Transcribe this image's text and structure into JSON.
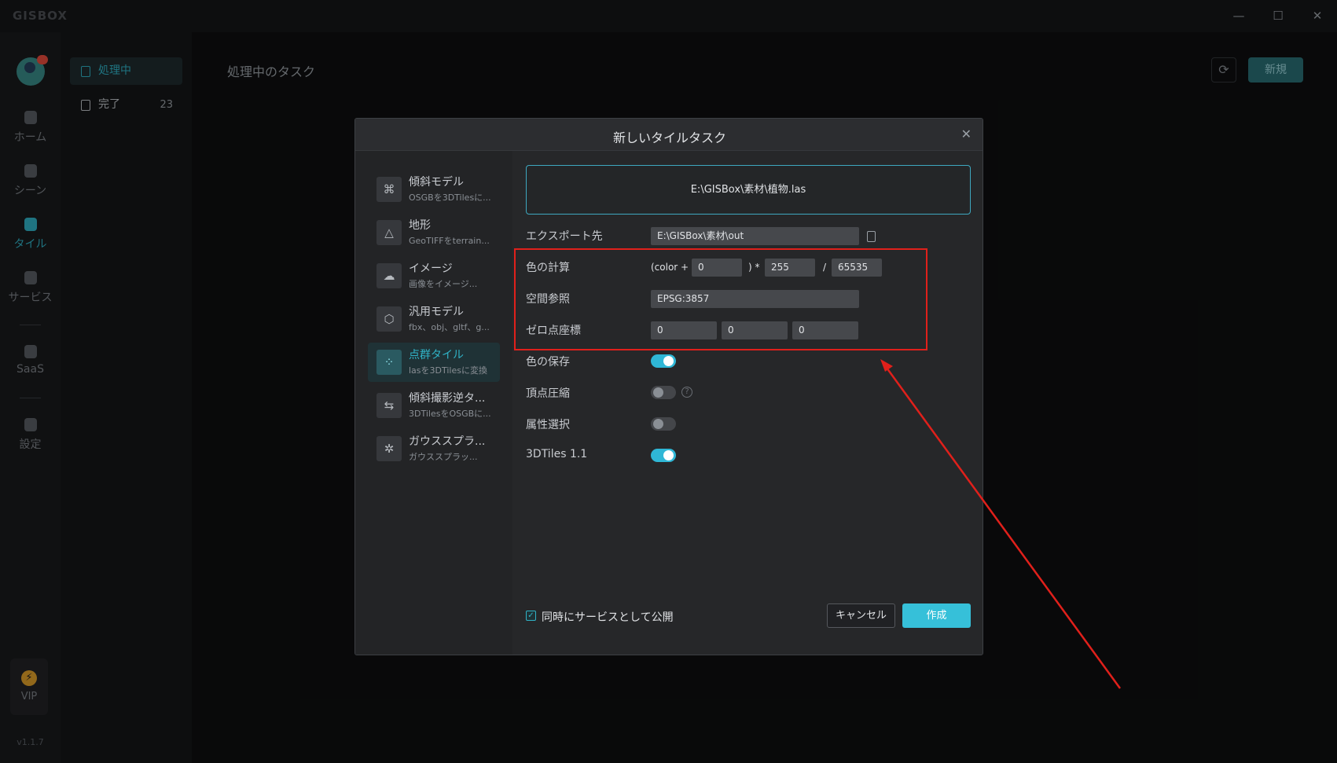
{
  "app": {
    "logo": "GISBOX",
    "version": "v1.1.7"
  },
  "window": {
    "minimize": "—",
    "maximize": "☐",
    "close": "✕"
  },
  "rail": {
    "items": [
      {
        "label": "ホーム"
      },
      {
        "label": "シーン"
      },
      {
        "label": "タイル"
      },
      {
        "label": "サービス"
      },
      {
        "label": "SaaS"
      },
      {
        "label": "設定"
      }
    ],
    "vip": "VIP",
    "vip_icon": "⚡"
  },
  "subside": {
    "items": [
      {
        "label": "処理中",
        "count": ""
      },
      {
        "label": "完了",
        "count": "23"
      }
    ]
  },
  "main": {
    "title": "処理中のタスク",
    "refresh_icon": "⟳",
    "new_label": "新規"
  },
  "dialog": {
    "title": "新しいタイルタスク",
    "close": "✕",
    "categories": [
      {
        "title": "傾斜モデル",
        "sub": "OSGBを3DTilesに...",
        "icon": "⌘"
      },
      {
        "title": "地形",
        "sub": "GeoTIFFをterrain...",
        "icon": "△"
      },
      {
        "title": "イメージ",
        "sub": "画像をイメージ...",
        "icon": "☁"
      },
      {
        "title": "汎用モデル",
        "sub": "fbx、obj、gltf、g...",
        "icon": "⬡"
      },
      {
        "title": "点群タイル",
        "sub": "lasを3DTilesに変換",
        "icon": "⁘"
      },
      {
        "title": "傾斜撮影逆タ...",
        "sub": "3DTilesをOSGBに...",
        "icon": "⇆"
      },
      {
        "title": "ガウススプラ...",
        "sub": "ガウススプラッ...",
        "icon": "✲"
      }
    ],
    "file": "E:\\GISBox\\素材\\植物.las",
    "export": {
      "label": "エクスポート先",
      "value": "E:\\GISBox\\素材\\out"
    },
    "color_calc": {
      "label": "色の計算",
      "prefix": "(color +",
      "offset": "0",
      "mid": ") *",
      "multiplier": "255",
      "div": "/",
      "divisor": "65535"
    },
    "spatial_ref": {
      "label": "空間参照",
      "value": "EPSG:3857"
    },
    "origin": {
      "label": "ゼロ点座標",
      "x": "0",
      "y": "0",
      "z": "0"
    },
    "toggles": [
      {
        "label": "色の保存",
        "on": true
      },
      {
        "label": "頂点圧縮",
        "on": false
      },
      {
        "label": "属性選択",
        "on": false
      },
      {
        "label": "3DTiles 1.1",
        "on": true
      }
    ],
    "help": "?",
    "publish_label": "同時にサービスとして公開",
    "publish_checked": true,
    "check_mark": "✓",
    "cancel": "キャンセル",
    "create": "作成"
  },
  "colors": {
    "accent": "#30b3c7",
    "annotation": "#e0201b"
  }
}
